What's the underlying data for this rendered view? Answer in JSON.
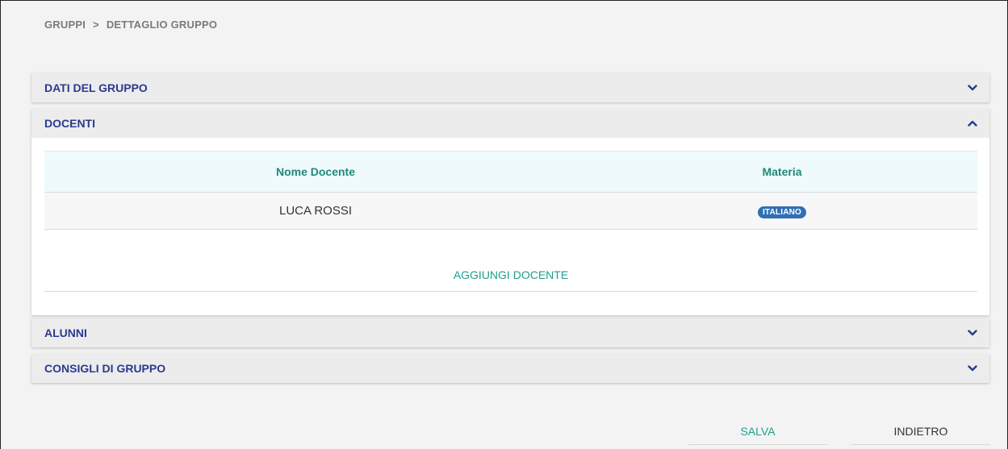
{
  "breadcrumb": {
    "root": "GRUPPI",
    "separator": ">",
    "current": "DETTAGLIO GRUPPO"
  },
  "sections": {
    "dati_gruppo": {
      "title": "DATI DEL GRUPPO",
      "state": "collapsed",
      "icon": "chevron-down-icon"
    },
    "docenti": {
      "title": "DOCENTI",
      "state": "expanded",
      "icon": "chevron-up-icon"
    },
    "alunni": {
      "title": "ALUNNI",
      "state": "collapsed",
      "icon": "chevron-down-icon"
    },
    "consigli": {
      "title": "CONSIGLI DI GRUPPO",
      "state": "collapsed",
      "icon": "chevron-down-icon"
    }
  },
  "docenti_table": {
    "columns": [
      "Nome Docente",
      "Materia"
    ],
    "rows": [
      {
        "nome": "LUCA ROSSI",
        "materia": "ITALIANO"
      }
    ]
  },
  "add_docente_label": "AGGIUNGI DOCENTE",
  "actions": {
    "save_label": "SALVA",
    "back_label": "INDIETRO"
  },
  "colors": {
    "section_title": "#2b3a8f",
    "accent_teal": "#1f9e8c",
    "badge_blue": "#2f6fb4",
    "table_header_bg": "#effafc"
  }
}
